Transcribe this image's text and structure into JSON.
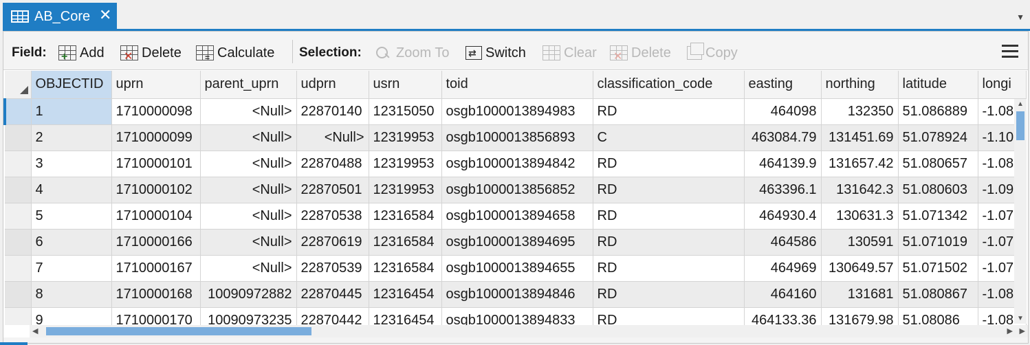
{
  "tab": {
    "title": "AB_Core",
    "close": "✕",
    "dropdown": "▼"
  },
  "toolbar": {
    "field_label": "Field:",
    "add": "Add",
    "delete": "Delete",
    "calculate": "Calculate",
    "selection_label": "Selection:",
    "zoom_to": "Zoom To",
    "switch": "Switch",
    "clear": "Clear",
    "delete_sel": "Delete",
    "copy": "Copy"
  },
  "table": {
    "columns": [
      "OBJECTID",
      "uprn",
      "parent_uprn",
      "udprn",
      "usrn",
      "toid",
      "classification_code",
      "easting",
      "northing",
      "latitude",
      "longi"
    ],
    "rows": [
      [
        "1",
        "1710000098",
        "<Null>",
        "22870140",
        "12315050",
        "osgb1000013894983",
        "RD",
        "464098",
        "132350",
        "51.086889",
        "-1.08"
      ],
      [
        "2",
        "1710000099",
        "<Null>",
        "<Null>",
        "12319953",
        "osgb1000013856893",
        "C",
        "463084.79",
        "131451.69",
        "51.078924",
        "-1.10"
      ],
      [
        "3",
        "1710000101",
        "<Null>",
        "22870488",
        "12319953",
        "osgb1000013894842",
        "RD",
        "464139.9",
        "131657.42",
        "51.080657",
        "-1.08"
      ],
      [
        "4",
        "1710000102",
        "<Null>",
        "22870501",
        "12319953",
        "osgb1000013856852",
        "RD",
        "463396.1",
        "131642.3",
        "51.080603",
        "-1.09"
      ],
      [
        "5",
        "1710000104",
        "<Null>",
        "22870538",
        "12316584",
        "osgb1000013894658",
        "RD",
        "464930.4",
        "130631.3",
        "51.071342",
        "-1.07"
      ],
      [
        "6",
        "1710000166",
        "<Null>",
        "22870619",
        "12316584",
        "osgb1000013894695",
        "RD",
        "464586",
        "130591",
        "51.071019",
        "-1.07"
      ],
      [
        "7",
        "1710000167",
        "<Null>",
        "22870539",
        "12316584",
        "osgb1000013894655",
        "RD",
        "464969",
        "130649.57",
        "51.071502",
        "-1.07"
      ],
      [
        "8",
        "1710000168",
        "10090972882",
        "22870445",
        "12316454",
        "osgb1000013894846",
        "RD",
        "464160",
        "131681",
        "51.080867",
        "-1.08"
      ],
      [
        "9",
        "1710000170",
        "10090973235",
        "22870442",
        "12316454",
        "osgb1000013894833",
        "RD",
        "464133.36",
        "131679.98",
        "51.08086",
        "-1.08"
      ]
    ]
  },
  "icons": {
    "tab": "table-icon",
    "add": "add-field-icon",
    "delete": "delete-field-icon",
    "calculate": "calculate-field-icon",
    "zoom": "zoom-to-icon",
    "switch": "switch-selection-icon",
    "clear": "clear-selection-icon",
    "delete_sel": "delete-selection-icon",
    "copy": "copy-selection-icon",
    "menu": "hamburger-menu-icon"
  },
  "colors": {
    "accent": "#1f7dc4",
    "selected": "#c6dbf0",
    "disabled": "#b8b8b8"
  }
}
